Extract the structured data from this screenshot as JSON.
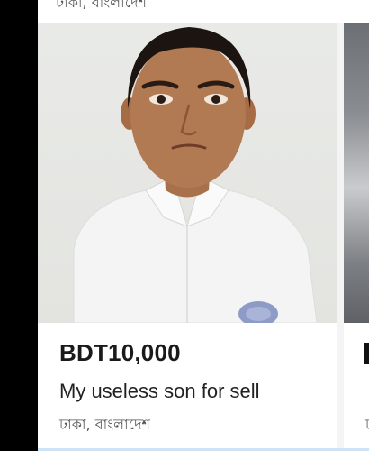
{
  "top_partial_text": "ঢাকা, বাংলাদেশ",
  "listing": {
    "price": "BDT10,000",
    "title": "My useless son for sell",
    "location": "ঢাকা, বাংলাদেশ",
    "image_icon": "person-photo-icon"
  },
  "next_listing": {
    "image_icon": "circuit-board-photo-icon",
    "location_partial": "ঢ"
  },
  "colors": {
    "price_text": "#1a1a1a",
    "body_text": "#222222",
    "secondary_text": "#555555",
    "background": "#ffffff"
  }
}
